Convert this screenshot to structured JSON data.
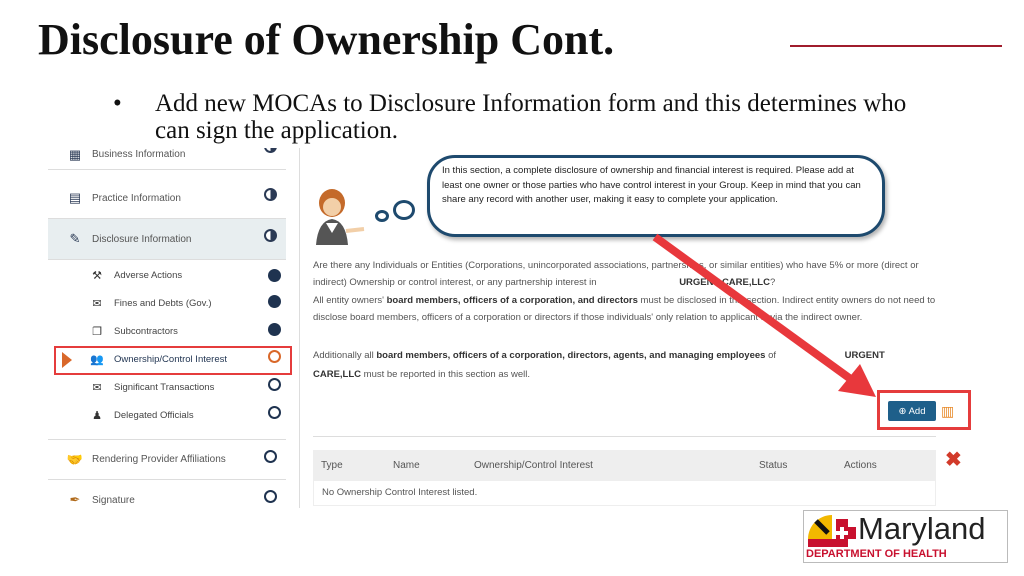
{
  "slide": {
    "title": "Disclosure of Ownership Cont.",
    "bullet": "Add new MOCAs to Disclosure Information form and this determines who can sign the application."
  },
  "sidebar": {
    "items": [
      {
        "label": "Business Information",
        "icon": "building-icon",
        "status": "half"
      },
      {
        "label": "Practice Information",
        "icon": "document-icon",
        "status": "half"
      },
      {
        "label": "Disclosure Information",
        "icon": "disclosure-icon",
        "status": "half"
      }
    ],
    "subitems": [
      {
        "label": "Adverse Actions",
        "icon": "gavel-icon",
        "status": "complete"
      },
      {
        "label": "Fines and Debts (Gov.)",
        "icon": "money-icon",
        "status": "complete"
      },
      {
        "label": "Subcontractors",
        "icon": "copy-icon",
        "status": "complete"
      },
      {
        "label": "Ownership/Control Interest",
        "icon": "users-icon",
        "status": "current"
      },
      {
        "label": "Significant Transactions",
        "icon": "money-icon",
        "status": "incomplete"
      },
      {
        "label": "Delegated Officials",
        "icon": "official-icon",
        "status": "incomplete"
      }
    ],
    "bottom": [
      {
        "label": "Rendering Provider Affiliations",
        "icon": "handshake-icon",
        "status": "incomplete"
      },
      {
        "label": "Signature",
        "icon": "pen-icon",
        "status": "incomplete"
      }
    ]
  },
  "bubble": "In this section, a complete disclosure of ownership and financial interest is required. Please add at least one owner or those parties who have control interest in your Group. Keep in mind that you can share any record with another user, making it easy to complete your application.",
  "main": {
    "p1a": "Are there any Individuals or Entities (Corporations, unincorporated associations, partnerships, or similar entities) who have 5% or more (direct or indirect) Ownership or control interest, or any partnership interest in",
    "p1org": "URGENT CARE,LLC",
    "p1end": "?",
    "p2a": "All entity owners'",
    "p2b": "board members, officers of a corporation, and directors",
    "p2c": "must be disclosed in this section. Indirect entity owners do not need to disclose board members, officers of a corporation or directors if those individuals' only relation to applicant is via the indirect owner.",
    "p3a": "Additionally all",
    "p3b": "board members, officers of a corporation, directors, agents, and managing employees",
    "p3c": "of",
    "p3org": "URGENT CARE,LLC",
    "p3d": "must be reported in this section as well.",
    "add_label": "Add",
    "table": {
      "headers": [
        "Type",
        "Name",
        "Ownership/Control Interest",
        "Status",
        "Actions"
      ],
      "empty": "No Ownership Control Interest listed."
    }
  },
  "logo": {
    "name": "Maryland",
    "sub": "DEPARTMENT OF HEALTH"
  },
  "colors": {
    "accent": "#e53c3c",
    "brand": "#1e4a6e",
    "title_rule": "#a01c2c"
  }
}
